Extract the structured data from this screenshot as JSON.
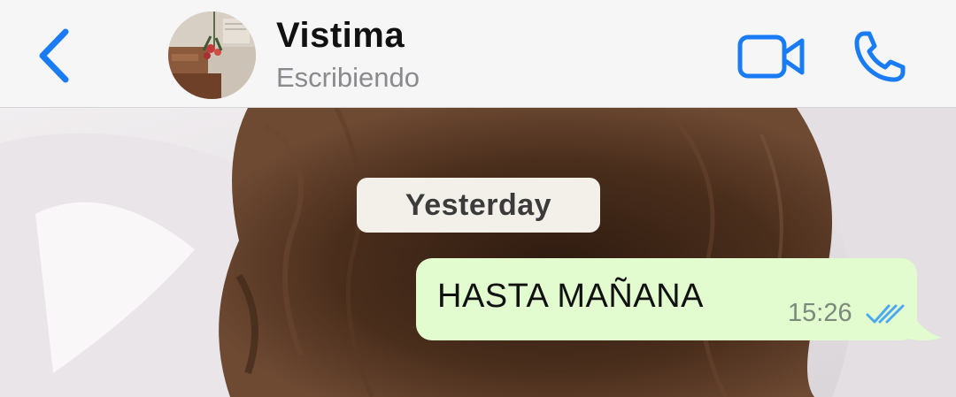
{
  "header": {
    "contact_name": "Vistima",
    "status": "Escribiendo",
    "back_icon": "chevron-left-icon",
    "video_icon": "video-camera-icon",
    "call_icon": "phone-icon",
    "accent_color": "#1a7cf5"
  },
  "chat": {
    "date_separator": "Yesterday",
    "messages": [
      {
        "direction": "outgoing",
        "text": "HASTA MAÑANA",
        "time": "15:26",
        "status_icon": "double-check-read-icon",
        "bubble_color": "#e2fbcf",
        "tick_color": "#4fa9f0"
      }
    ]
  }
}
